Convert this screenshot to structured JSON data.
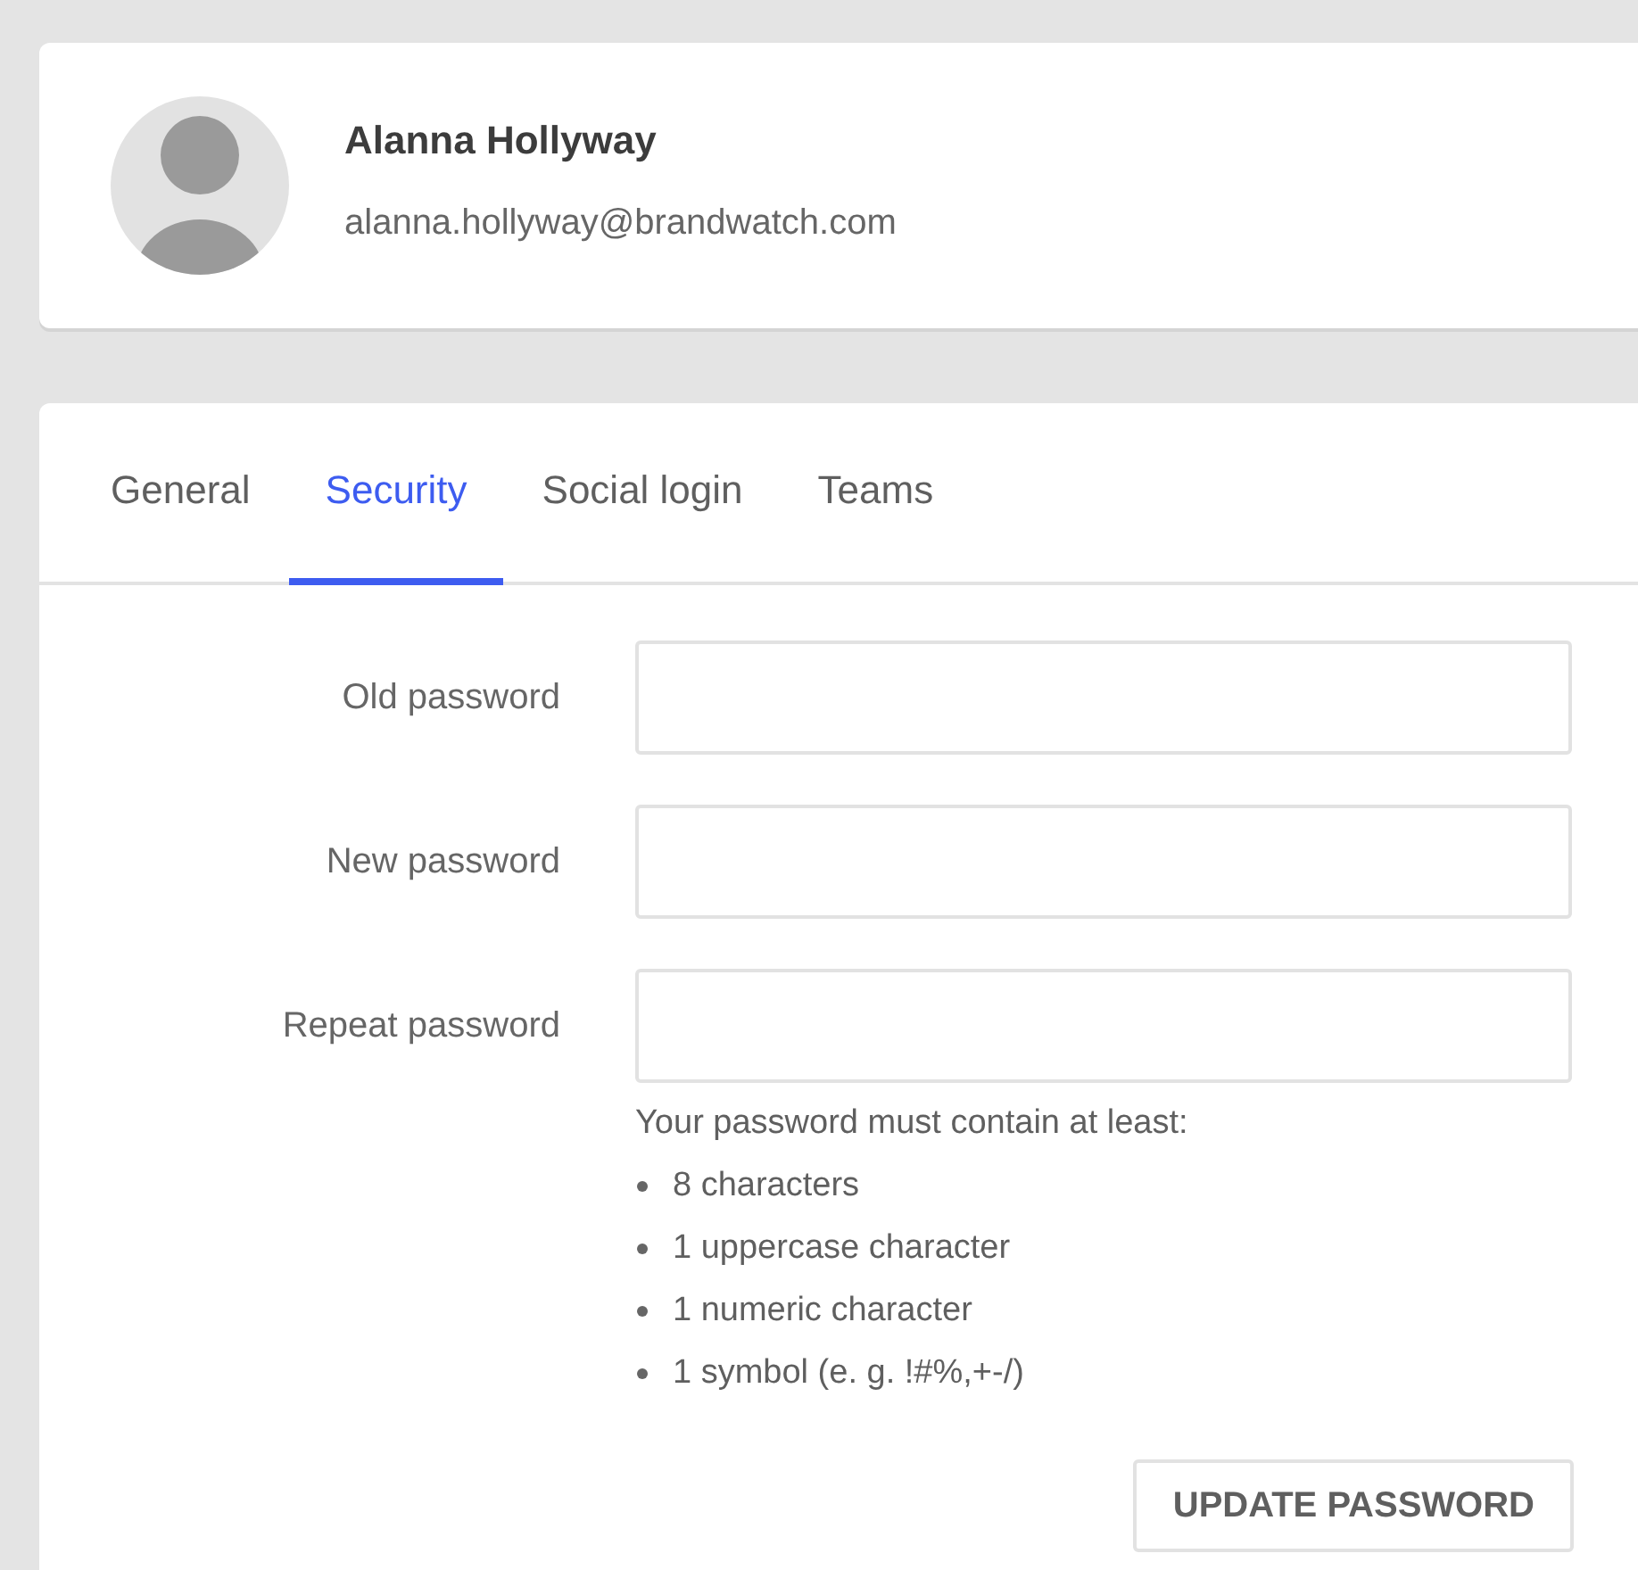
{
  "profile": {
    "name": "Alanna Hollyway",
    "email": "alanna.hollyway@brandwatch.com"
  },
  "tabs": [
    {
      "label": "General",
      "selected": false
    },
    {
      "label": "Security",
      "selected": true
    },
    {
      "label": "Social login",
      "selected": false
    },
    {
      "label": "Teams",
      "selected": false
    }
  ],
  "fields": [
    {
      "label": "Old password"
    },
    {
      "label": "New password"
    },
    {
      "label": "Repeat password"
    }
  ],
  "requirements": {
    "intro": "Your password must contain at least:",
    "items": [
      "8 characters",
      "1 uppercase character",
      "1 numeric character",
      "1 symbol (e. g. !#%,+-/)"
    ]
  },
  "button": "UPDATE PASSWORD"
}
